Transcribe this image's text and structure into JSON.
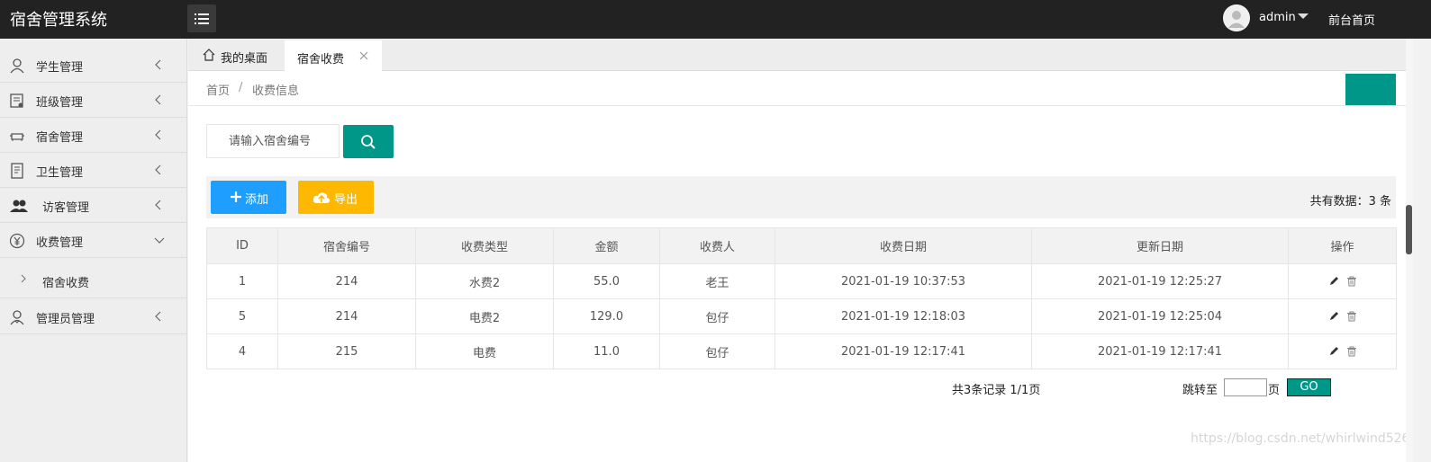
{
  "header": {
    "app_title": "宿舍管理系统",
    "user_name": "admin",
    "front_link": "前台首页"
  },
  "sidebar": {
    "items": [
      {
        "label": "学生管理",
        "icon": "user-icon"
      },
      {
        "label": "班级管理",
        "icon": "class-icon"
      },
      {
        "label": "宿舍管理",
        "icon": "sofa-icon"
      },
      {
        "label": "卫生管理",
        "icon": "document-icon"
      },
      {
        "label": "访客管理",
        "icon": "users-icon"
      },
      {
        "label": "收费管理",
        "icon": "yen-icon"
      },
      {
        "label": "管理员管理",
        "icon": "admin-icon"
      }
    ],
    "sub_item": "宿舍收费"
  },
  "tabs": {
    "home_label": "我的桌面",
    "active_label": "宿舍收费"
  },
  "breadcrumb": {
    "home": "首页",
    "separator": "/",
    "current": "收费信息"
  },
  "search": {
    "placeholder": "请输入宿舍编号"
  },
  "toolbar": {
    "add_label": "添加",
    "export_label": "导出",
    "total": "共有数据：3 条"
  },
  "table": {
    "headers": [
      "ID",
      "宿舍编号",
      "收费类型",
      "金额",
      "收费人",
      "收费日期",
      "更新日期",
      "操作"
    ],
    "rows": [
      [
        "1",
        "214",
        "水费2",
        "55.0",
        "老王",
        "2021-01-19 10:37:53",
        "2021-01-19 12:25:27"
      ],
      [
        "5",
        "214",
        "电费2",
        "129.0",
        "包仔",
        "2021-01-19 12:18:03",
        "2021-01-19 12:25:04"
      ],
      [
        "4",
        "215",
        "电费",
        "11.0",
        "包仔",
        "2021-01-19 12:17:41",
        "2021-01-19 12:17:41"
      ]
    ]
  },
  "pager": {
    "info": "共3条记录  1/1页",
    "jump_label": "跳转至",
    "page_unit": "页",
    "go_label": "GO"
  },
  "watermark": "https://blog.csdn.net/whirlwind526",
  "colors": {
    "primary": "#009688",
    "blue": "#1e9fff",
    "warm": "#ffb800",
    "header": "#222222"
  }
}
